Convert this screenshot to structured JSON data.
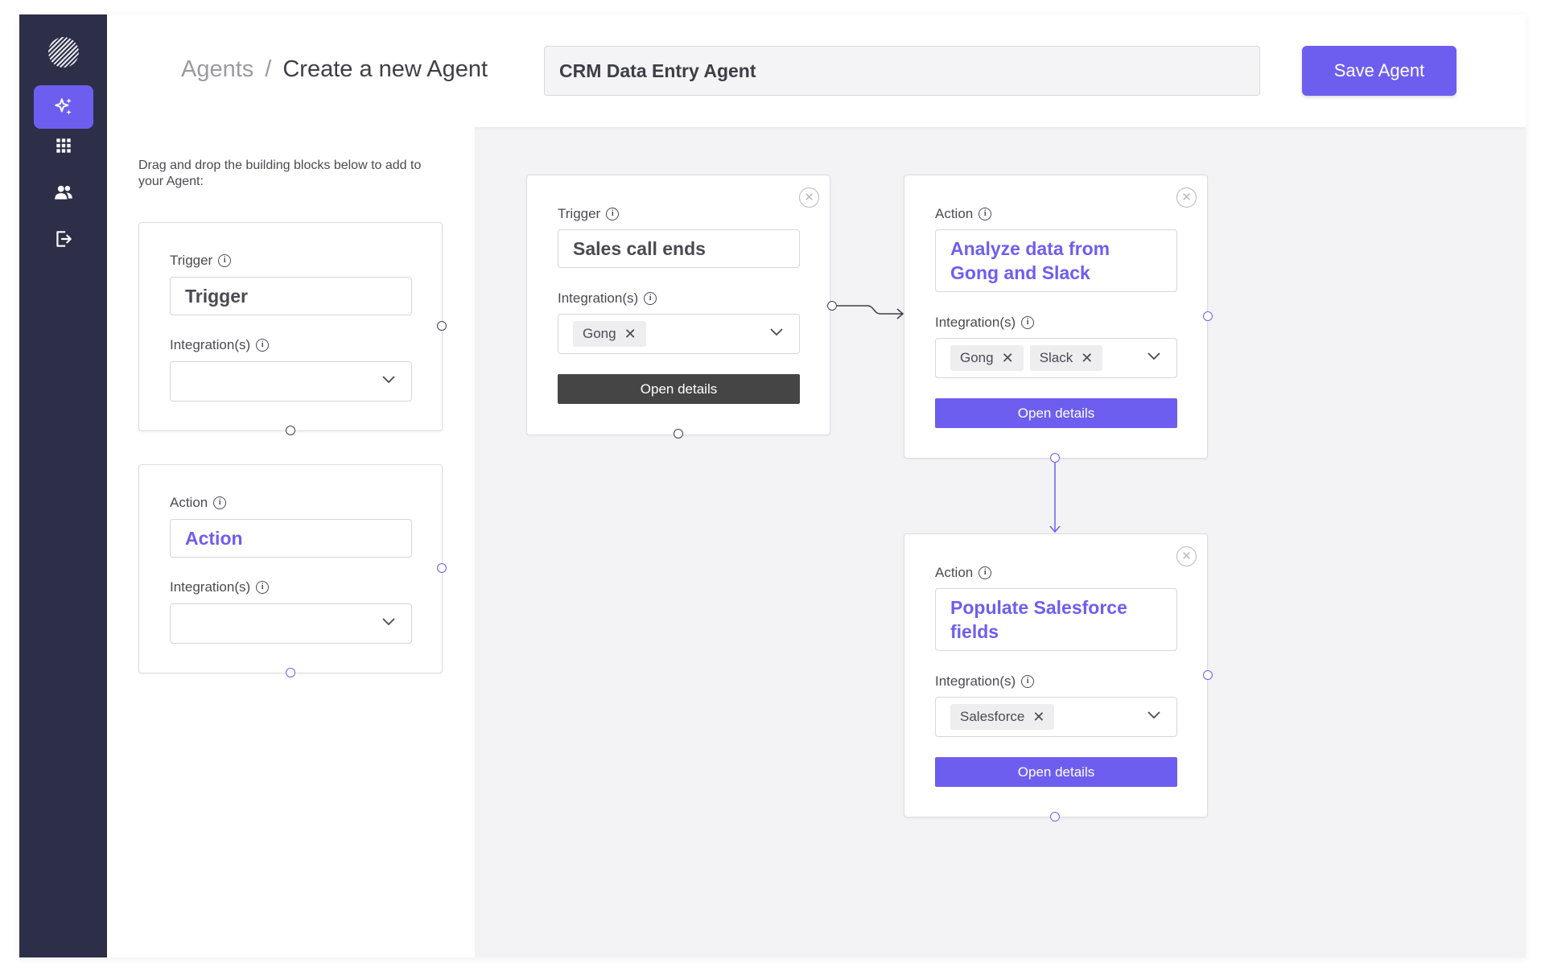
{
  "sidebar": {
    "logo_icon": "logo-icon",
    "items": [
      {
        "icon": "sparkles-icon",
        "active": true
      },
      {
        "icon": "grid-icon",
        "active": false
      },
      {
        "icon": "users-icon",
        "active": false
      },
      {
        "icon": "logout-icon",
        "active": false
      }
    ],
    "accent": "#6d5ef0",
    "background": "#2d2f48"
  },
  "header": {
    "breadcrumb_parent": "Agents",
    "breadcrumb_separator": "/",
    "breadcrumb_current": "Create a new Agent",
    "agent_name_value": "CRM Data Entry Agent",
    "save_label": "Save Agent"
  },
  "palette": {
    "hint": "Drag and drop the building blocks below to add to your Agent:",
    "trigger_block": {
      "label": "Trigger",
      "name": "Trigger",
      "integrations_label": "Integration(s)"
    },
    "action_block": {
      "label": "Action",
      "name": "Action",
      "integrations_label": "Integration(s)"
    }
  },
  "canvas": {
    "trigger_node": {
      "label": "Trigger",
      "name": "Sales call ends",
      "integrations_label": "Integration(s)",
      "integrations": [
        "Gong"
      ],
      "open_label": "Open details"
    },
    "action_node_1": {
      "label": "Action",
      "name": "Analyze data from Gong and Slack",
      "integrations_label": "Integration(s)",
      "integrations": [
        "Gong",
        "Slack"
      ],
      "open_label": "Open details"
    },
    "action_node_2": {
      "label": "Action",
      "name": "Populate Salesforce fields",
      "integrations_label": "Integration(s)",
      "integrations": [
        "Salesforce"
      ],
      "open_label": "Open details"
    }
  },
  "glyphs": {
    "info": "i",
    "remove": "✕",
    "close": "✕"
  }
}
